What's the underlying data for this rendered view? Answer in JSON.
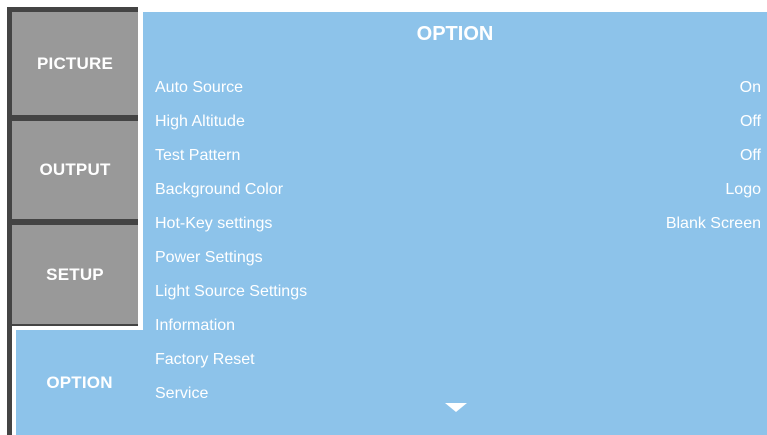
{
  "tabs": [
    {
      "label": "PICTURE"
    },
    {
      "label": "OUTPUT"
    },
    {
      "label": "SETUP"
    },
    {
      "label": "OPTION"
    }
  ],
  "panel": {
    "title": "OPTION",
    "items": [
      {
        "label": "Auto Source",
        "value": "On"
      },
      {
        "label": "High Altitude",
        "value": "Off"
      },
      {
        "label": "Test Pattern",
        "value": "Off"
      },
      {
        "label": "Background Color",
        "value": "Logo"
      },
      {
        "label": "Hot-Key settings",
        "value": "Blank Screen"
      },
      {
        "label": "Power Settings",
        "value": ""
      },
      {
        "label": "Light Source Settings",
        "value": ""
      },
      {
        "label": "Information",
        "value": ""
      },
      {
        "label": "Factory Reset",
        "value": ""
      },
      {
        "label": "Service",
        "value": ""
      }
    ],
    "scroll_indicator": "down-arrow-icon"
  },
  "colors": {
    "frame": "#444444",
    "inactive_tab": "#999999",
    "active_tab": "#8dc3ea",
    "panel": "#8dc3ea",
    "text": "#ffffff"
  }
}
